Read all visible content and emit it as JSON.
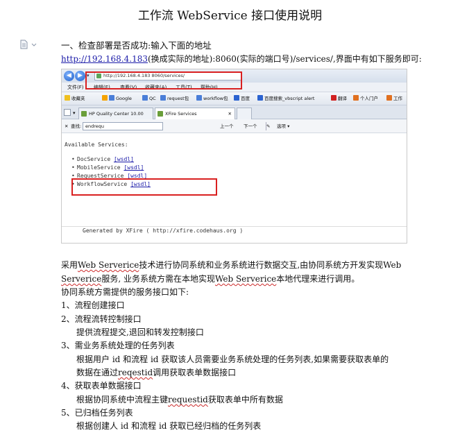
{
  "document": {
    "title": "工作流 WebService 接口使用说明",
    "section_heading": "一、检查部署是否成功:输入下面的地址",
    "url_link": "http://192.168.4.183",
    "url_rest": "(换成实际的地址):8060(实际的端口号)/services/,界面中有如下服务即可:"
  },
  "screenshot": {
    "address": "http://192.168.4.183 8060/services/",
    "menu": [
      "文件(F)",
      "编辑(E)",
      "查看(V)",
      "收藏夹(A)",
      "工具(T)",
      "帮助(H)"
    ],
    "favorites": [
      "收藏夹",
      "Google",
      "QC",
      "request包",
      "workflow包",
      "百度",
      "百度搜索_vbscript alert",
      "翻译",
      "个人门户",
      "工作"
    ],
    "tabs": [
      "HP Quality Center 10.00",
      "XFire Services"
    ],
    "find_label": "查找:",
    "find_value": "endrequ",
    "find_prev": "上一个",
    "find_next": "下一个",
    "find_options": "选项",
    "available_services": "Available Services:",
    "services": [
      {
        "name": "DocService",
        "link": "[wsdl]"
      },
      {
        "name": "MobileService",
        "link": "[wsdl]"
      },
      {
        "name": "RequestService",
        "link": "[wsdl]"
      },
      {
        "name": "WorkflowService",
        "link": "[wsdl]"
      }
    ],
    "generated_by": "Generated by XFire ( http://xfire.codehaus.org )"
  },
  "body": {
    "p1_a": "采用",
    "p1_ws": "Web Serverice",
    "p1_b": "技术进行协同系统和业务系统进行数据交互,由协同系统方开发实现",
    "p1_c": "Web",
    "p2_ws": "Serverice",
    "p2_a": "服务, 业务系统方需在本地实现",
    "p2_ws2": "Web Serverice",
    "p2_b": "本地代理来进行调用。",
    "p3": "协同系统方需提供的服务接口如下:"
  },
  "items": [
    {
      "title": "1、流程创建接口"
    },
    {
      "title": "2、流程流转控制接口",
      "detail": "提供流程提交,退回和转发控制接口"
    },
    {
      "title": "3、需业务系统处理的任务列表",
      "detail": "根据用户 id 和流程 id 获取该人员需要业务系统处理的任务列表,如果需要获取表单的",
      "detail2_a": "数据在通过",
      "detail2_term": "reqestid",
      "detail2_b": "调用获取表单数据接口"
    },
    {
      "title": "4、获取表单数据接口",
      "detail_a": "根据协同系统中流程主键",
      "detail_term": "requestid",
      "detail_b": "获取表单中所有数据"
    },
    {
      "title": "5、已归档任务列表",
      "detail": "根据创建人 id 和流程 id 获取已经归档的任务列表"
    }
  ]
}
